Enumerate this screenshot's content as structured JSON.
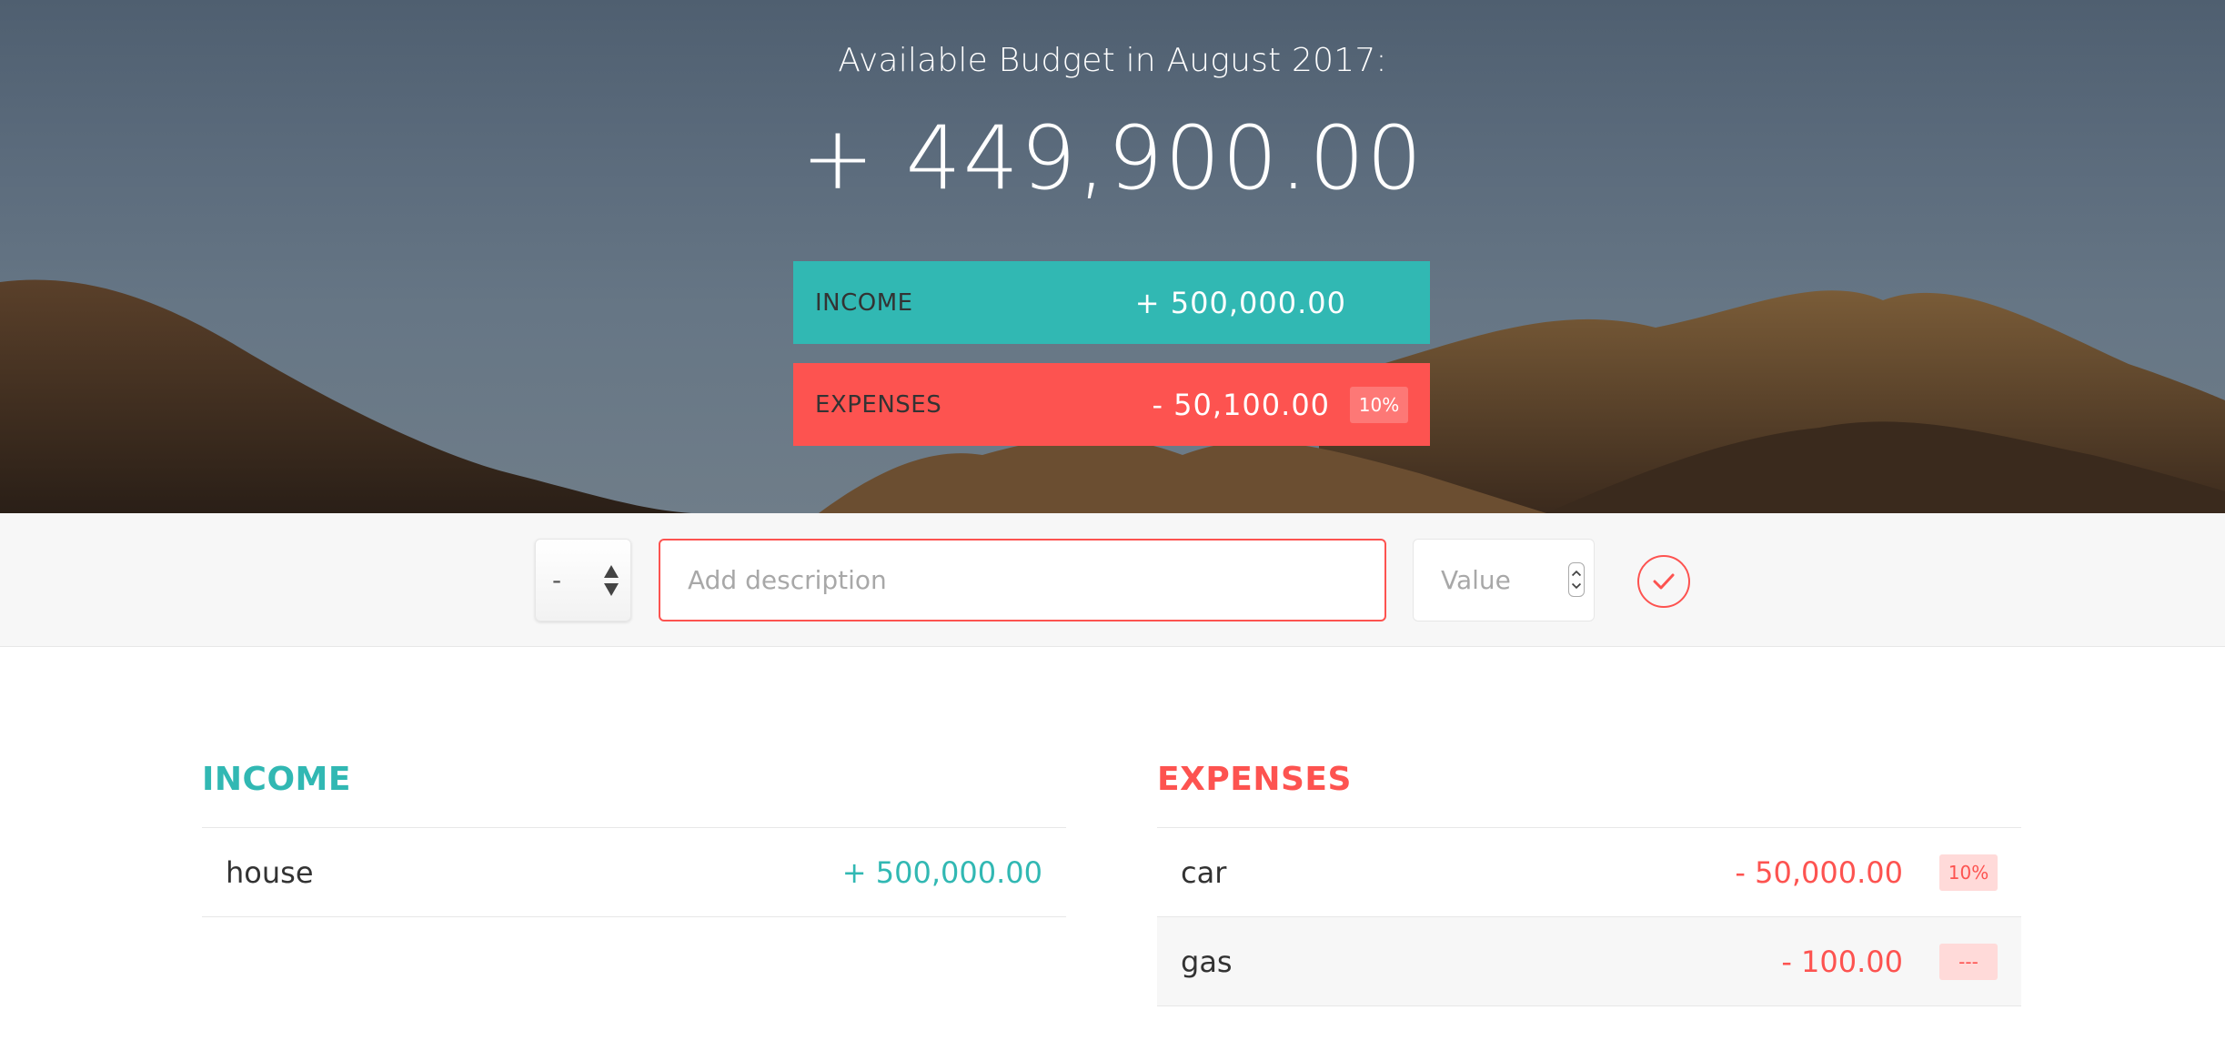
{
  "header": {
    "title": "Available Budget in August 2017:",
    "available_budget": "+ 449,900.00"
  },
  "summary": {
    "income": {
      "label": "Income",
      "value": "+ 500,000.00"
    },
    "expenses": {
      "label": "Expenses",
      "value": "- 50,100.00",
      "percentage": "10%"
    }
  },
  "add_form": {
    "type_selected": "-",
    "description_placeholder": "Add description",
    "value_placeholder": "Value"
  },
  "income_list": {
    "title": "Income",
    "items": [
      {
        "description": "house",
        "value": "+ 500,000.00"
      }
    ]
  },
  "expenses_list": {
    "title": "Expenses",
    "items": [
      {
        "description": "car",
        "value": "- 50,000.00",
        "percentage": "10%"
      },
      {
        "description": "gas",
        "value": "- 100.00",
        "percentage": "---"
      }
    ]
  },
  "colors": {
    "income": "#31b8b3",
    "expenses": "#fd5350",
    "badge_bg": "#ffdad9",
    "bar_bg": "#f7f7f7"
  },
  "icons": {
    "add_button": "checkmark-circle-icon",
    "type_select": "up-down-arrows-icon"
  }
}
